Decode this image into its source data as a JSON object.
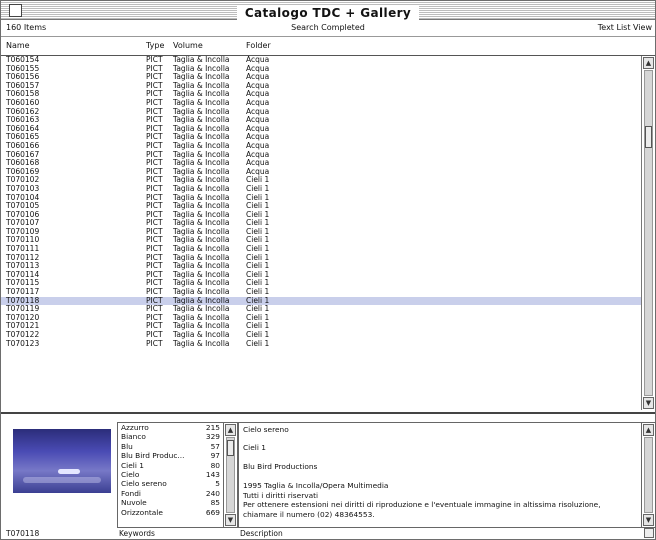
{
  "window": {
    "title": "Catalogo TDC + Gallery"
  },
  "infobar": {
    "items": "160 Items",
    "status": "Search Completed",
    "view_mode": "Text List View"
  },
  "columns": {
    "name": "Name",
    "type": "Type",
    "volume": "Volume",
    "folder": "Folder"
  },
  "rows": [
    {
      "name": "T060154",
      "type": "PICT",
      "volume": "Taglia & Incolla",
      "folder": "Acqua"
    },
    {
      "name": "T060155",
      "type": "PICT",
      "volume": "Taglia & Incolla",
      "folder": "Acqua"
    },
    {
      "name": "T060156",
      "type": "PICT",
      "volume": "Taglia & Incolla",
      "folder": "Acqua"
    },
    {
      "name": "T060157",
      "type": "PICT",
      "volume": "Taglia & Incolla",
      "folder": "Acqua"
    },
    {
      "name": "T060158",
      "type": "PICT",
      "volume": "Taglia & Incolla",
      "folder": "Acqua"
    },
    {
      "name": "T060160",
      "type": "PICT",
      "volume": "Taglia & Incolla",
      "folder": "Acqua"
    },
    {
      "name": "T060162",
      "type": "PICT",
      "volume": "Taglia & Incolla",
      "folder": "Acqua"
    },
    {
      "name": "T060163",
      "type": "PICT",
      "volume": "Taglia & Incolla",
      "folder": "Acqua"
    },
    {
      "name": "T060164",
      "type": "PICT",
      "volume": "Taglia & Incolla",
      "folder": "Acqua"
    },
    {
      "name": "T060165",
      "type": "PICT",
      "volume": "Taglia & Incolla",
      "folder": "Acqua"
    },
    {
      "name": "T060166",
      "type": "PICT",
      "volume": "Taglia & Incolla",
      "folder": "Acqua"
    },
    {
      "name": "T060167",
      "type": "PICT",
      "volume": "Taglia & Incolla",
      "folder": "Acqua"
    },
    {
      "name": "T060168",
      "type": "PICT",
      "volume": "Taglia & Incolla",
      "folder": "Acqua"
    },
    {
      "name": "T060169",
      "type": "PICT",
      "volume": "Taglia & Incolla",
      "folder": "Acqua"
    },
    {
      "name": "T070102",
      "type": "PICT",
      "volume": "Taglia & Incolla",
      "folder": "Cieli 1"
    },
    {
      "name": "T070103",
      "type": "PICT",
      "volume": "Taglia & Incolla",
      "folder": "Cieli 1"
    },
    {
      "name": "T070104",
      "type": "PICT",
      "volume": "Taglia & Incolla",
      "folder": "Cieli 1"
    },
    {
      "name": "T070105",
      "type": "PICT",
      "volume": "Taglia & Incolla",
      "folder": "Cieli 1"
    },
    {
      "name": "T070106",
      "type": "PICT",
      "volume": "Taglia & Incolla",
      "folder": "Cieli 1"
    },
    {
      "name": "T070107",
      "type": "PICT",
      "volume": "Taglia & Incolla",
      "folder": "Cieli 1"
    },
    {
      "name": "T070109",
      "type": "PICT",
      "volume": "Taglia & Incolla",
      "folder": "Cieli 1"
    },
    {
      "name": "T070110",
      "type": "PICT",
      "volume": "Taglia & Incolla",
      "folder": "Cieli 1"
    },
    {
      "name": "T070111",
      "type": "PICT",
      "volume": "Taglia & Incolla",
      "folder": "Cieli 1"
    },
    {
      "name": "T070112",
      "type": "PICT",
      "volume": "Taglia & Incolla",
      "folder": "Cieli 1"
    },
    {
      "name": "T070113",
      "type": "PICT",
      "volume": "Taglia & Incolla",
      "folder": "Cieli 1"
    },
    {
      "name": "T070114",
      "type": "PICT",
      "volume": "Taglia & Incolla",
      "folder": "Cieli 1"
    },
    {
      "name": "T070115",
      "type": "PICT",
      "volume": "Taglia & Incolla",
      "folder": "Cieli 1"
    },
    {
      "name": "T070117",
      "type": "PICT",
      "volume": "Taglia & Incolla",
      "folder": "Cieli 1"
    },
    {
      "name": "T070118",
      "type": "PICT",
      "volume": "Taglia & Incolla",
      "folder": "Cieli 1",
      "selected": true
    },
    {
      "name": "T070119",
      "type": "PICT",
      "volume": "Taglia & Incolla",
      "folder": "Cieli 1"
    },
    {
      "name": "T070120",
      "type": "PICT",
      "volume": "Taglia & Incolla",
      "folder": "Cieli 1"
    },
    {
      "name": "T070121",
      "type": "PICT",
      "volume": "Taglia & Incolla",
      "folder": "Cieli 1"
    },
    {
      "name": "T070122",
      "type": "PICT",
      "volume": "Taglia & Incolla",
      "folder": "Cieli 1"
    },
    {
      "name": "T070123",
      "type": "PICT",
      "volume": "Taglia & Incolla",
      "folder": "Cieli 1"
    }
  ],
  "keywords": [
    {
      "name": "Azzurro",
      "count": "215"
    },
    {
      "name": "Bianco",
      "count": "329"
    },
    {
      "name": "Blu",
      "count": "57"
    },
    {
      "name": "Blu Bird Produc...",
      "count": "97"
    },
    {
      "name": "Cieli 1",
      "count": "80"
    },
    {
      "name": "Cielo",
      "count": "143"
    },
    {
      "name": "Cielo sereno",
      "count": "5"
    },
    {
      "name": "Fondi",
      "count": "240"
    },
    {
      "name": "Nuvole",
      "count": "85"
    },
    {
      "name": "Orizzontale",
      "count": "669"
    }
  ],
  "description": {
    "line1": "Cielo sereno",
    "line2": "Cieli 1",
    "line3": "Blu Bird Productions",
    "line4": "1995 Taglia & Incolla/Opera Multimedia",
    "line5": "Tutti i diritti riservati",
    "line6": "Per ottenere estensioni nei diritti di riproduzione e l'eventuale immagine in altissima risoluzione,",
    "line7": "chiamare il numero (02) 48364553."
  },
  "footer": {
    "selected_name": "T070118",
    "keywords_label": "Keywords",
    "description_label": "Description"
  },
  "colors": {
    "selection": "#c9cfeb",
    "thumbnail_sky": "#4a4bb4"
  },
  "icons": [
    "close-box-icon",
    "scroll-up-arrow-icon",
    "scroll-down-arrow-icon",
    "grow-box-icon"
  ]
}
